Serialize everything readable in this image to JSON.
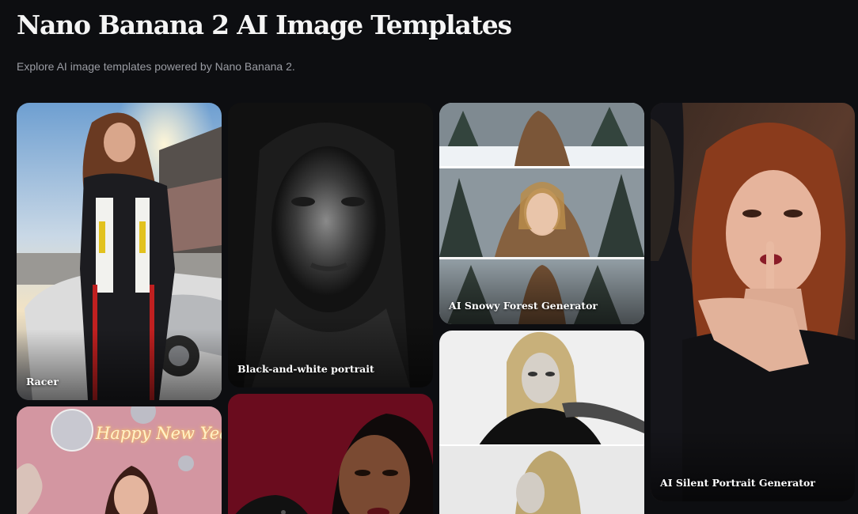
{
  "header": {
    "title": "Nano Banana 2 AI Image Templates",
    "subtitle": "Explore AI image templates powered by Nano Banana 2."
  },
  "templates": [
    {
      "label": "Racer"
    },
    {
      "label": "Black-and-white portrait"
    },
    {
      "label": "AI Snowy Forest Generator"
    },
    {
      "label": "AI Silent Portrait Generator"
    },
    {
      "label": "Happy New Year"
    },
    {
      "label": ""
    },
    {
      "label": ""
    }
  ]
}
